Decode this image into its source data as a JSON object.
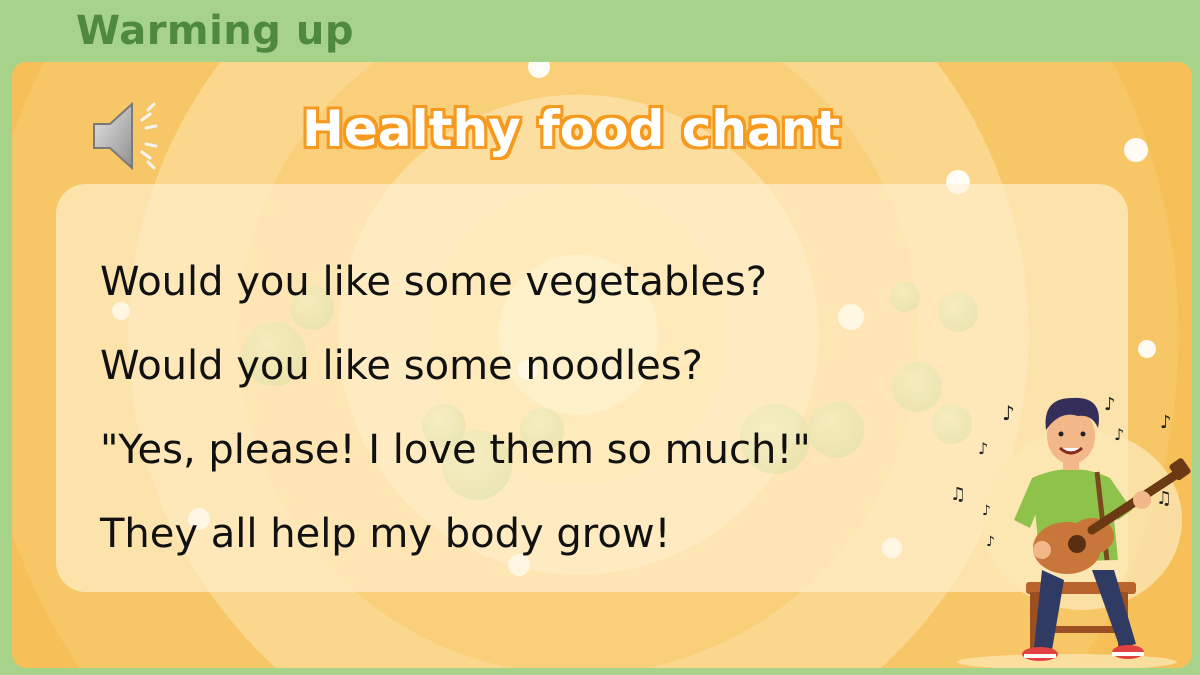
{
  "header": {
    "section_title": "Warming up"
  },
  "slide": {
    "title": "Healthy food chant",
    "lyrics": [
      "Would you like some vegetables?",
      "Would you like some noodles?",
      "\"Yes, please! I love them so much!\"",
      "They all help my body grow!"
    ]
  },
  "icons": {
    "speaker": "speaker-icon",
    "illustration": "guitar-player-illustration"
  },
  "colors": {
    "header_bg": "#a6d28a",
    "header_text": "#4f8a3c",
    "title_outline": "#f59a1f",
    "stage_bg": "#f7c767"
  }
}
